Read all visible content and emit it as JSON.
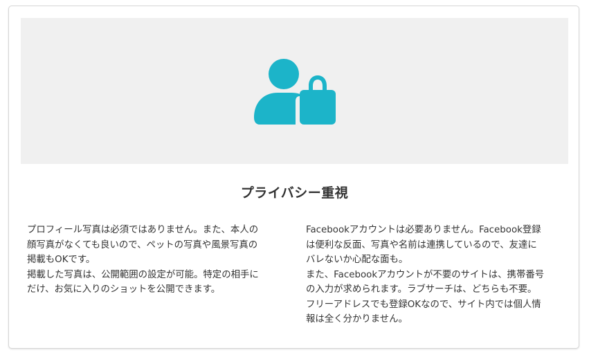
{
  "section": {
    "icon": "user-lock-icon",
    "icon_color": "#1cb4c9",
    "title": "プライバシー重視",
    "left_paragraphs": [
      "プロフィール写真は必須ではありません。また、本人の\n顔写真がなくても良いので、ペットの写真や風景写真の\n掲載もOKです。",
      "掲載した写真は、公開範囲の設定が可能。特定の相手に\nだけ、お気に入りのショットを公開できます。"
    ],
    "right_paragraphs": [
      "Facebookアカウントは必要ありません。Facebook登録\nは便利な反面、写真や名前は連携しているので、友達に\nバレないか心配な面も。",
      "また、Facebookアカウントが不要のサイトは、携帯番号\nの入力が求められます。ラブサーチは、どちらも不要。\nフリーアドレスでも登録OKなので、サイト内では個人情\n報は全く分かりません。"
    ]
  }
}
